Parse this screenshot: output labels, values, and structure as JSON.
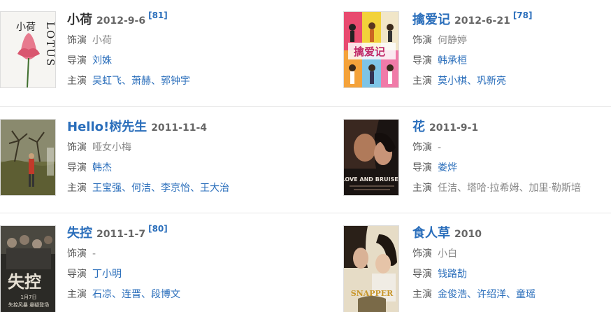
{
  "labels": {
    "role": "饰演",
    "director": "导演",
    "cast": "主演"
  },
  "films": [
    {
      "title": "小荷",
      "date": "2012-9-6",
      "ref": "[81]",
      "role": "小荷",
      "director": [
        "刘姝"
      ],
      "cast": [
        "吴虹飞",
        "萧赫",
        "郭钟宇"
      ],
      "poster": {
        "title_text": "小荷",
        "side_text": "LOTUS",
        "bg": "#f4f4f2"
      }
    },
    {
      "title": "擒爱记",
      "date": "2012-6-21",
      "ref": "[78]",
      "role": "何静婷",
      "director": [
        "韩承桓"
      ],
      "cast": [
        "莫小棋",
        "巩新亮"
      ],
      "poster": {
        "title_text": "擒爱记",
        "bg": "#e9d14a"
      }
    },
    {
      "title": "Hello!树先生",
      "date": "2011-11-4",
      "ref": "",
      "role": "哑女小梅",
      "director": [
        "韩杰"
      ],
      "cast": [
        "王宝强",
        "何洁",
        "李京怡",
        "王大治"
      ],
      "poster": {
        "bg": "#6f7158"
      }
    },
    {
      "title": "花",
      "date": "2011-9-1",
      "ref": "",
      "role": "-",
      "director": [
        "娄烨"
      ],
      "cast": [
        "任洁",
        "塔哈·拉希姆",
        "加里·勒斯培"
      ],
      "cast_plain": true,
      "poster": {
        "title_text": "LOVE AND BRUISES",
        "bg": "#1a1412"
      }
    },
    {
      "title": "失控",
      "date": "2011-1-7",
      "ref": "[80]",
      "role": "-",
      "director": [
        "丁小明"
      ],
      "cast": [
        "石凉",
        "连晋",
        "段博文"
      ],
      "poster": {
        "title_text": "失控",
        "sub_text": "1月7日",
        "sub_text2": "失控风暴 悬疑登场",
        "bg": "#2b2a26"
      }
    },
    {
      "title": "食人草",
      "date": "2010",
      "ref": "",
      "role": "小白",
      "director": [
        "钱路劼"
      ],
      "cast": [
        "金俊浩",
        "许绍洋",
        "童瑶"
      ],
      "poster": {
        "title_text": "SNAPPER",
        "bg": "#d9c9a4"
      }
    }
  ]
}
